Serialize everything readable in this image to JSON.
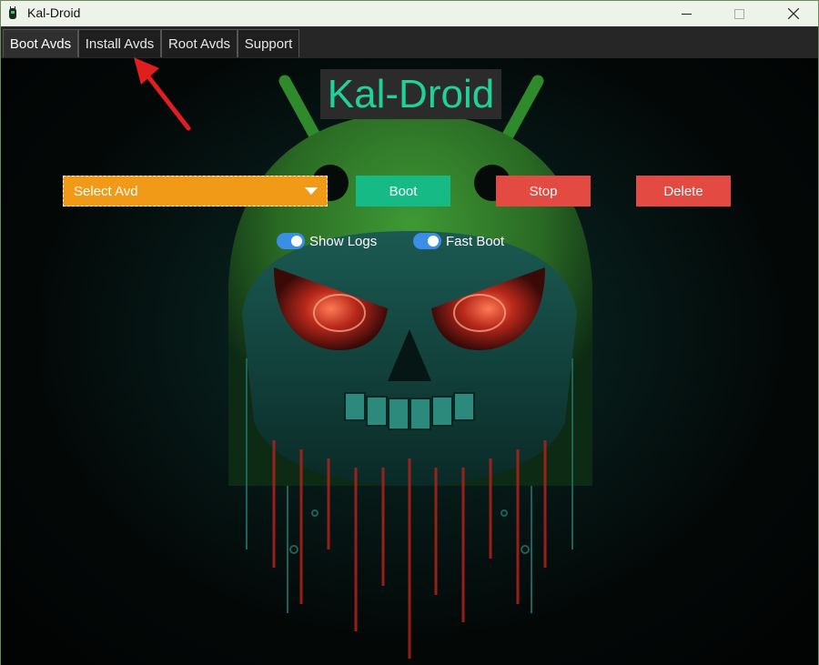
{
  "window": {
    "title": "Kal-Droid"
  },
  "tabs": [
    {
      "label": "Boot Avds",
      "active": true
    },
    {
      "label": "Install Avds",
      "active": false
    },
    {
      "label": "Root Avds",
      "active": false
    },
    {
      "label": "Support",
      "active": false
    }
  ],
  "main": {
    "title": "Kal-Droid",
    "select": {
      "placeholder": "Select Avd"
    },
    "buttons": {
      "boot": "Boot",
      "stop": "Stop",
      "delete": "Delete"
    },
    "toggles": {
      "show_logs": {
        "label": "Show Logs",
        "checked": true
      },
      "fast_boot": {
        "label": "Fast Boot",
        "checked": true
      }
    }
  },
  "colors": {
    "accent_green": "#15ba84",
    "title_green": "#1ed29a",
    "select_orange": "#f09a18",
    "danger_red": "#e34a42",
    "toggle_blue": "#3a8ee6",
    "annotation_arrow": "#e01e1e"
  },
  "icons": {
    "app": "android-robot-icon",
    "minimize": "minimize-icon",
    "maximize": "maximize-icon",
    "close": "close-icon",
    "dropdown": "chevron-down-icon"
  }
}
